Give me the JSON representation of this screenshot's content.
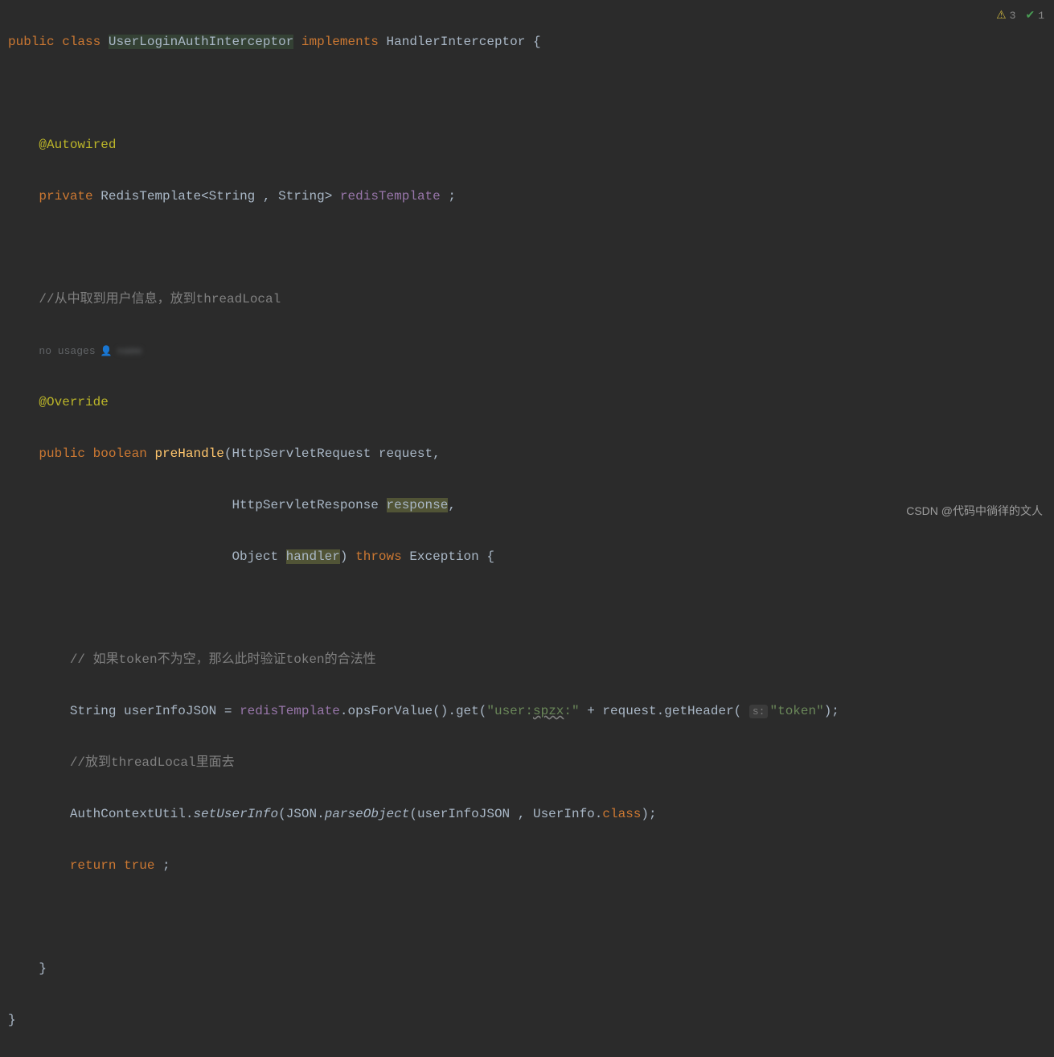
{
  "code": {
    "line1": {
      "public": "public",
      "class": "class",
      "className": "UserLoginAuthInterceptor",
      "implements": "implements",
      "interface": "HandlerInterceptor",
      "brace": "{"
    },
    "line3": {
      "annotation": "@Autowired"
    },
    "line4": {
      "private": "private",
      "type1": "RedisTemplate",
      "generic1": "String",
      "generic2": "String",
      "field": "redisTemplate",
      "semi": ";"
    },
    "line6": {
      "comment": "//从中取到用户信息，放到threadLocal"
    },
    "line7": {
      "hint": "no usages",
      "author": "name"
    },
    "line8": {
      "annotation": "@Override"
    },
    "line9": {
      "public": "public",
      "boolean": "boolean",
      "method": "preHandle",
      "paramType1": "HttpServletRequest",
      "paramName1": "request"
    },
    "line10": {
      "paramType2": "HttpServletResponse",
      "paramName2": "response"
    },
    "line11": {
      "paramType3": "Object",
      "paramName3": "handler",
      "throws": "throws",
      "exception": "Exception",
      "brace": "{"
    },
    "line13": {
      "comment": "// 如果token不为空，那么此时验证token的合法性"
    },
    "line14": {
      "type": "String",
      "var": "userInfoJSON",
      "eq": "=",
      "field": "redisTemplate",
      "method1": "opsForValue",
      "method2": "get",
      "string1": "\"user:",
      "string1b": "spzx",
      "string1c": ":\"",
      "plus": "+",
      "var2": "request",
      "method3": "getHeader",
      "paramHint": "s:",
      "string2": "\"token\"",
      "end": ");"
    },
    "line15": {
      "comment": "//放到threadLocal里面去"
    },
    "line16": {
      "class1": "AuthContextUtil",
      "method1": "setUserInfo",
      "class2": "JSON",
      "method2": "parseObject",
      "arg1": "userInfoJSON",
      "class3": "UserInfo",
      "classRef": "class",
      "end": ");"
    },
    "line17": {
      "return": "return",
      "true": "true",
      "semi": ";"
    },
    "line19": {
      "brace": "}"
    },
    "line20": {
      "brace": "}"
    }
  },
  "status": {
    "warnings": "3",
    "checks": "1"
  },
  "watermark": "CSDN @代码中徜徉的文人"
}
